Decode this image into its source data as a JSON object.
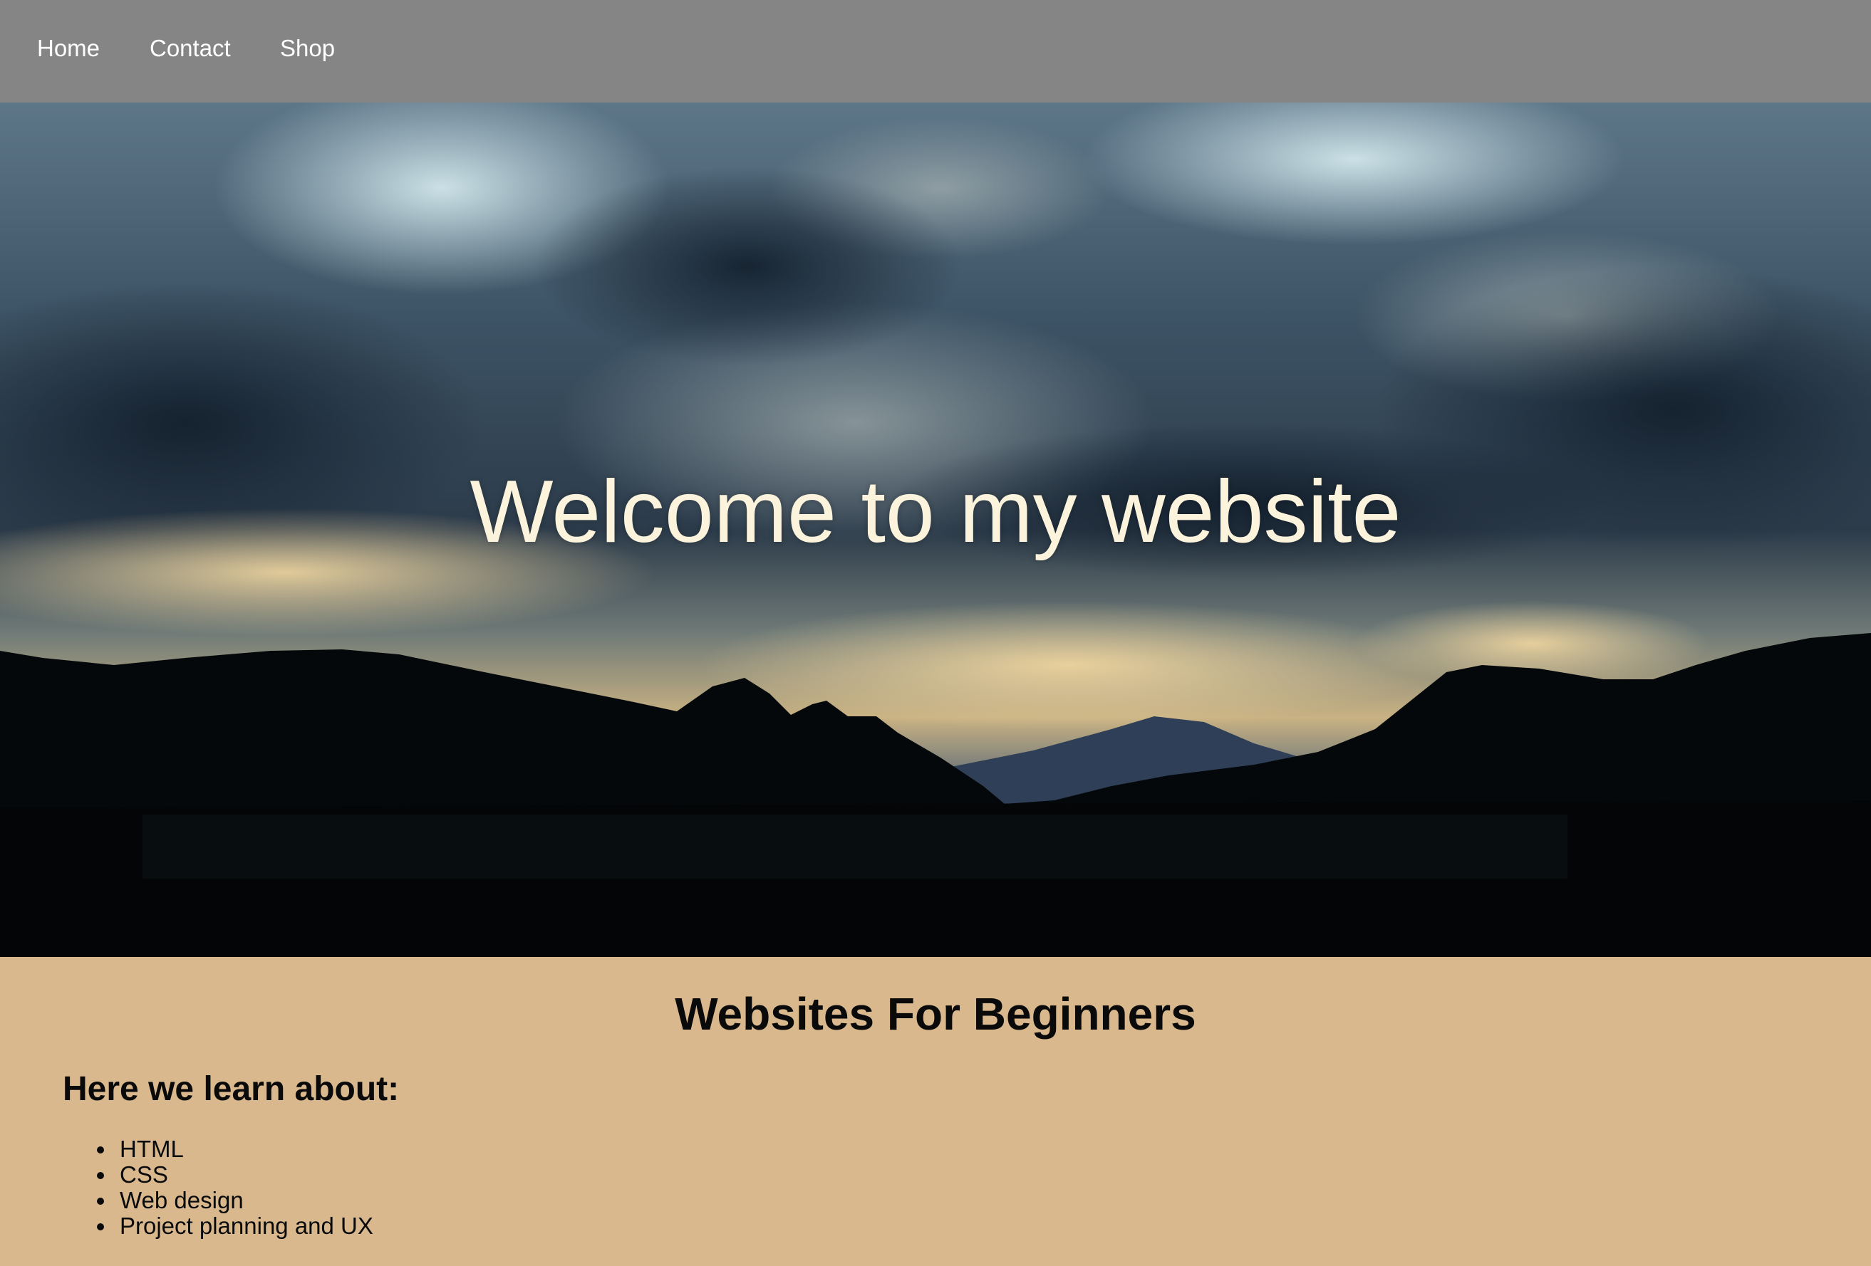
{
  "nav": {
    "items": [
      {
        "label": "Home"
      },
      {
        "label": "Contact"
      },
      {
        "label": "Shop"
      }
    ]
  },
  "hero": {
    "title": "Welcome to my website"
  },
  "content": {
    "heading": "Websites For Beginners",
    "subheading": "Here we learn about:",
    "topics": [
      "HTML",
      "CSS",
      "Web design",
      "Project planning and UX"
    ]
  },
  "colors": {
    "navbar": "#858585",
    "content_background": "#d9b88e",
    "hero_title": "#fbf3dc"
  }
}
